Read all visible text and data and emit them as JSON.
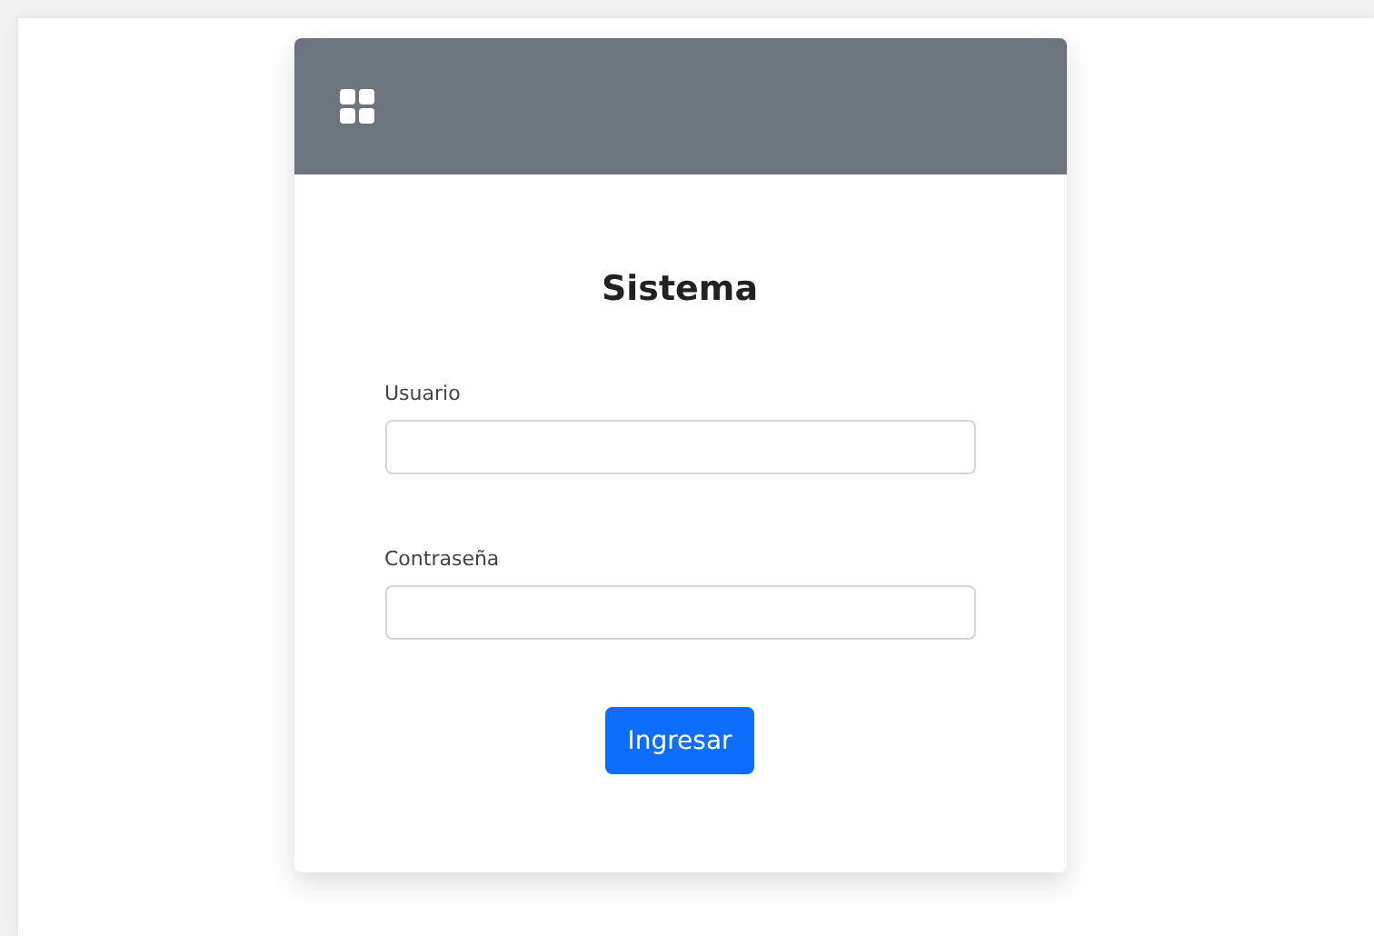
{
  "card": {
    "title": "Sistema"
  },
  "fields": [
    {
      "label": "Usuario"
    },
    {
      "label": "Contraseña"
    }
  ],
  "submit": {
    "label": "Ingresar"
  }
}
